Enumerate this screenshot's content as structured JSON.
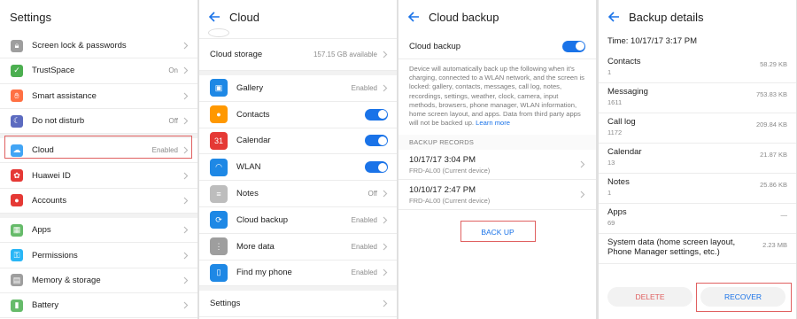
{
  "colors": {
    "accent": "#1a73e8",
    "highlight": "#e06060",
    "delete": "#e06060"
  },
  "panel1": {
    "title": "Settings",
    "items": [
      {
        "label": "Screen lock & passwords",
        "value": "",
        "icon": "lock-icon",
        "color": "#9e9e9e"
      },
      {
        "label": "TrustSpace",
        "value": "On",
        "icon": "shield-icon",
        "color": "#4caf50"
      },
      {
        "label": "Smart assistance",
        "value": "",
        "icon": "hand-icon",
        "color": "#ff7043"
      },
      {
        "label": "Do not disturb",
        "value": "Off",
        "icon": "moon-icon",
        "color": "#5c6bc0"
      },
      {
        "label": "Cloud",
        "value": "Enabled",
        "icon": "cloud-icon",
        "color": "#42a5f5"
      },
      {
        "label": "Huawei ID",
        "value": "",
        "icon": "huawei-icon",
        "color": "#e53935"
      },
      {
        "label": "Accounts",
        "value": "",
        "icon": "person-icon",
        "color": "#e53935"
      },
      {
        "label": "Apps",
        "value": "",
        "icon": "apps-icon",
        "color": "#66bb6a"
      },
      {
        "label": "Permissions",
        "value": "",
        "icon": "key-icon",
        "color": "#29b6f6"
      },
      {
        "label": "Memory & storage",
        "value": "",
        "icon": "storage-icon",
        "color": "#9e9e9e"
      },
      {
        "label": "Battery",
        "value": "",
        "icon": "battery-icon",
        "color": "#66bb6a"
      }
    ]
  },
  "panel2": {
    "title": "Cloud",
    "storage_label": "Cloud storage",
    "storage_value": "157.15 GB available",
    "items": [
      {
        "label": "Gallery",
        "value": "Enabled",
        "toggle": false,
        "icon": "gallery-icon",
        "color": "#1e88e5"
      },
      {
        "label": "Contacts",
        "value": "",
        "toggle": true,
        "icon": "contacts-icon",
        "color": "#ff9800"
      },
      {
        "label": "Calendar",
        "value": "",
        "toggle": true,
        "icon": "calendar-icon",
        "color": "#e53935",
        "glyph": "31"
      },
      {
        "label": "WLAN",
        "value": "",
        "toggle": true,
        "icon": "wifi-icon",
        "color": "#1e88e5"
      },
      {
        "label": "Notes",
        "value": "Off",
        "toggle": false,
        "icon": "notes-icon",
        "color": "#bdbdbd"
      },
      {
        "label": "Cloud backup",
        "value": "Enabled",
        "toggle": false,
        "icon": "cloud-backup-icon",
        "color": "#1e88e5"
      },
      {
        "label": "More data",
        "value": "Enabled",
        "toggle": false,
        "icon": "more-icon",
        "color": "#9e9e9e"
      },
      {
        "label": "Find my phone",
        "value": "Enabled",
        "toggle": false,
        "icon": "phone-icon",
        "color": "#1e88e5"
      }
    ],
    "settings_label": "Settings"
  },
  "panel3": {
    "title": "Cloud backup",
    "toggle_label": "Cloud backup",
    "description": "Device will automatically back up the following when it's charging, connected to a WLAN network, and the screen is locked: gallery, contacts, messages, call log, notes, recordings, settings, weather, clock, camera, input methods, browsers, phone manager, WLAN information, home screen layout, and apps. Data from third party apps will not be backed up.",
    "learn_more": "Learn more",
    "records_header": "BACKUP RECORDS",
    "records": [
      {
        "time": "10/17/17 3:04 PM",
        "device": "FRD-AL00 (Current device)"
      },
      {
        "time": "10/10/17 2:47 PM",
        "device": "FRD-AL00 (Current device)"
      }
    ],
    "back_up_label": "BACK UP"
  },
  "panel4": {
    "title": "Backup details",
    "time": "Time: 10/17/17 3:17 PM",
    "items": [
      {
        "name": "Contacts",
        "count": "1",
        "size": "58.29 KB"
      },
      {
        "name": "Messaging",
        "count": "1611",
        "size": "753.83 KB"
      },
      {
        "name": "Call log",
        "count": "1172",
        "size": "209.84 KB"
      },
      {
        "name": "Calendar",
        "count": "13",
        "size": "21.87 KB"
      },
      {
        "name": "Notes",
        "count": "1",
        "size": "25.86 KB"
      },
      {
        "name": "Apps",
        "count": "69",
        "size": "—"
      },
      {
        "name": "System data (home screen layout, Phone Manager settings, etc.)",
        "count": "",
        "size": "2.23 MB"
      }
    ],
    "delete_label": "DELETE",
    "recover_label": "RECOVER"
  }
}
